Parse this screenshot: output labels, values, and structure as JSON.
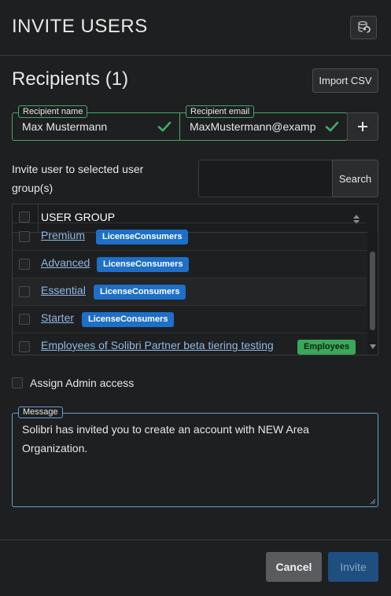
{
  "header": {
    "title": "INVITE USERS",
    "refresh_icon": "refresh-database-icon"
  },
  "recipients": {
    "title": "Recipients (1)",
    "import_label": "Import CSV",
    "name_label": "Recipient name",
    "name_value": "Max Mustermann",
    "email_label": "Recipient email",
    "email_value": "MaxMustermann@examp",
    "add_icon": "plus-icon",
    "valid_color": "#46a86a"
  },
  "groups": {
    "label": "Invite user to selected user group(s)",
    "search_placeholder": "",
    "search_label": "Search",
    "column_header": "USER GROUP",
    "rows": [
      {
        "name": "Premium",
        "badge": "LicenseConsumers",
        "badge_color": "#1e6fc8"
      },
      {
        "name": "Advanced",
        "badge": "LicenseConsumers",
        "badge_color": "#1e6fc8"
      },
      {
        "name": "Essential",
        "badge": "LicenseConsumers",
        "badge_color": "#1e6fc8"
      },
      {
        "name": "Starter",
        "badge": "LicenseConsumers",
        "badge_color": "#1e6fc8"
      },
      {
        "name": "Employees of Solibri Partner beta tiering testing",
        "badge": "Employees",
        "badge_color": "#3aa85a"
      }
    ]
  },
  "admin": {
    "label": "Assign Admin access"
  },
  "message": {
    "label": "Message",
    "text": "Solibri has invited you to create an account with NEW Area Organization."
  },
  "footer": {
    "cancel_label": "Cancel",
    "invite_label": "Invite"
  }
}
